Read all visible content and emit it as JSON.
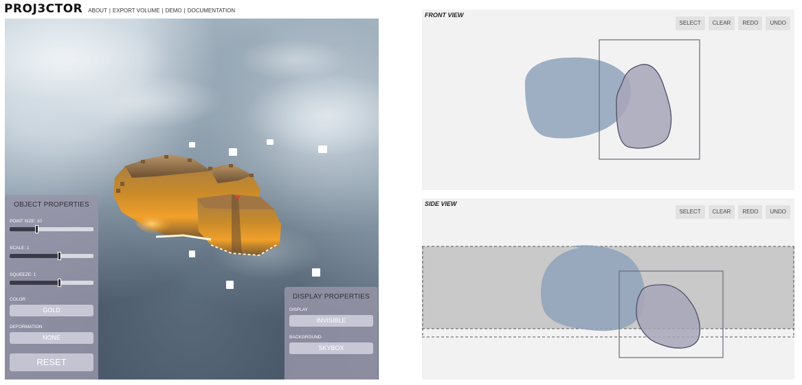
{
  "app": {
    "brand": "PROJ3CTOR",
    "nav": [
      "ABOUT",
      "EXPORT VOLUME",
      "DEMO",
      "DOCUMENTATION"
    ]
  },
  "object_properties": {
    "title": "OBJECT PROPERTIES",
    "point_size": {
      "label": "POINT SIZE: 10",
      "level": 0.33
    },
    "scale": {
      "label": "SCALE: 1",
      "level": 0.6
    },
    "squeeze": {
      "label": "SQUEEZE: 1",
      "level": 0.6
    },
    "color": {
      "label": "COLOR",
      "value": "GOLD"
    },
    "deformation": {
      "label": "DEFORMATION",
      "value": "NONE"
    },
    "reset_label": "RESET"
  },
  "display_properties": {
    "title": "DISPLAY PROPERTIES",
    "display": {
      "label": "DISPLAY",
      "value": "INVISIBLE"
    },
    "background": {
      "label": "BACKGROUND",
      "value": "SKYBOX"
    }
  },
  "front_view": {
    "title": "FRONT VIEW",
    "buttons": [
      "SELECT",
      "CLEAR",
      "REDO",
      "UNDO"
    ]
  },
  "side_view": {
    "title": "SIDE VIEW",
    "buttons": [
      "SELECT",
      "CLEAR",
      "REDO",
      "UNDO"
    ]
  },
  "colors": {
    "panel": "#9694a8",
    "object_gold": "#e8962a",
    "shape_blue": "#8fa3bb",
    "shape_gray": "#a7a6b8"
  }
}
